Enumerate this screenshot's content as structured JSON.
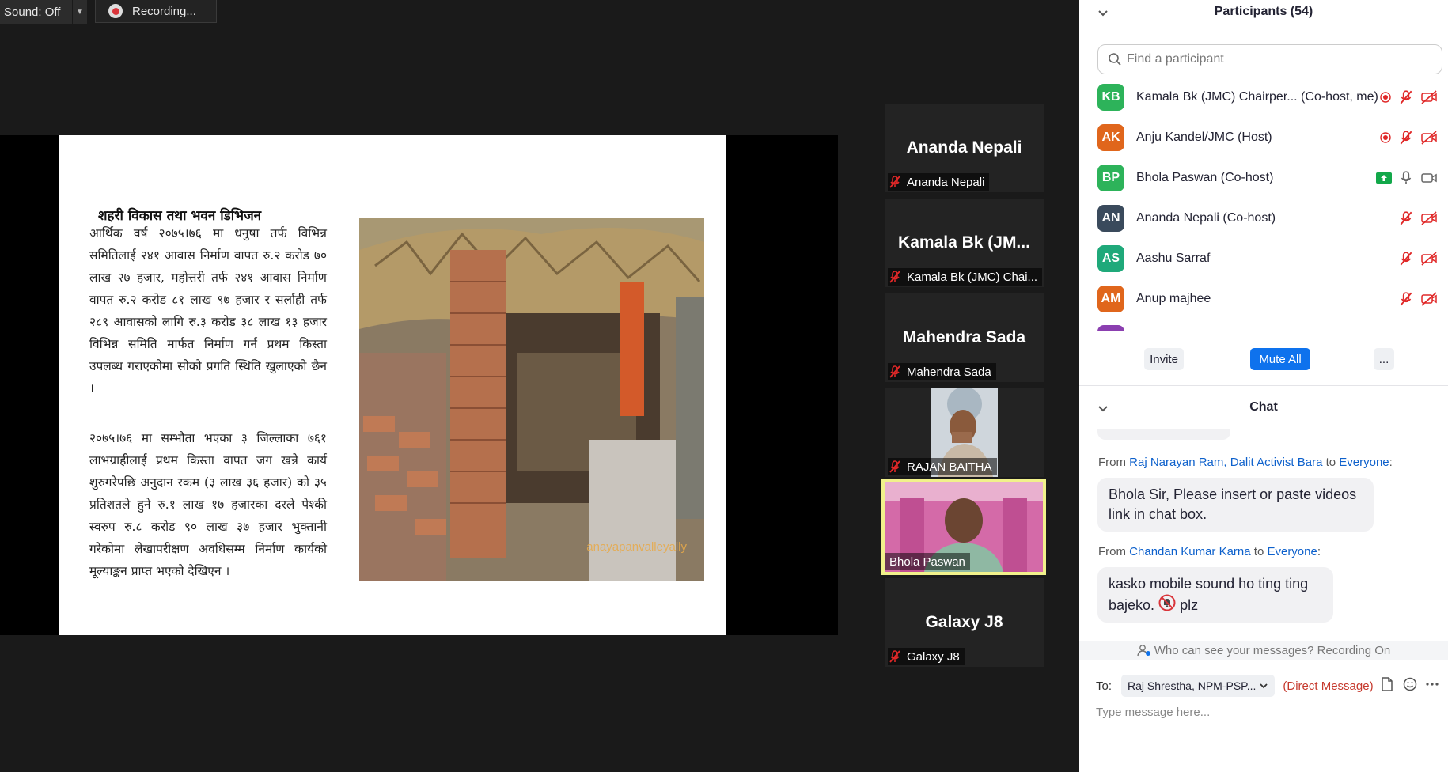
{
  "topbar": {
    "sound_label": "Sound: Off",
    "recording_label": "Recording..."
  },
  "slide": {
    "title": "शहरी विकास तथा भवन डिभिजन",
    "paragraph1": "आर्थिक वर्ष २०७५।७६ मा धनुषा तर्फ विभिन्न समितिलाई २४१ आवास निर्माण वापत रु.२ करोड ७० लाख २७ हजार, महोत्तरी तर्फ २४१ आवास निर्माण वापत रु.२ करोड ८१ लाख ९७ हजार र सर्लाही तर्फ २८९ आवासको लागि रु.३ करोड ३८ लाख १३ हजार विभिन्न समिति मार्फत निर्माण गर्न प्रथम किस्ता उपलब्ध गराएकोमा सोको प्रगति स्थिति खुलाएको छैन ।",
    "paragraph2": "२०७५।७६ मा सम्भौता भएका ३ जिल्लाका ७६१ लाभग्राहीलाई प्रथम किस्ता वापत जग खन्ने कार्य शुरुगरेपछि अनुदान रकम (३ लाख ३६ हजार) को ३५ प्रतिशतले हुने रु.१ लाख १७ हजारका दरले पेश्की स्वरुप रु.८ करोड ९० लाख ३७ हजार भुक्तानी गरेकोमा लेखापरीक्षण अवधिसम्म निर्माण कार्यको मूल्याङ्कन प्राप्त भएको देखिएन ।",
    "photo_watermark": "anayapanvalleyally"
  },
  "tiles": [
    {
      "display": "Ananda Nepali",
      "label": "Ananda Nepali",
      "video": false
    },
    {
      "display": "Kamala Bk  (JM...",
      "label": "Kamala Bk  (JMC) Chai...",
      "video": false
    },
    {
      "display": "Mahendra Sada",
      "label": "Mahendra Sada",
      "video": false
    },
    {
      "display": "",
      "label": "RAJAN BAITHA",
      "video": true
    },
    {
      "display": "",
      "label": "Bhola Paswan",
      "video": true
    },
    {
      "display": "Galaxy J8",
      "label": "Galaxy J8",
      "video": false
    }
  ],
  "participants_panel": {
    "title": "Participants (54)",
    "search_placeholder": "Find a participant",
    "participants": [
      {
        "initials": "KB",
        "color": "#2db35a",
        "name": "Kamala Bk  (JMC) Chairper...  (Co-host, me)"
      },
      {
        "initials": "AK",
        "color": "#e0661c",
        "name": "Anju Kandel/JMC (Host)"
      },
      {
        "initials": "BP",
        "color": "#2db35a",
        "name": "Bhola Paswan (Co-host)"
      },
      {
        "initials": "AN",
        "color": "#3a4a5c",
        "name": "Ananda Nepali (Co-host)"
      },
      {
        "initials": "AS",
        "color": "#1fa97a",
        "name": "Aashu Sarraf"
      },
      {
        "initials": "AM",
        "color": "#e0661c",
        "name": "Anup majhee"
      }
    ],
    "invite_label": "Invite",
    "mute_all_label": "Mute All",
    "more_label": "..."
  },
  "chat": {
    "title": "Chat",
    "messages": [
      {
        "from_word": "From",
        "sender": "Raj Narayan Ram, Dalit Activist Bara",
        "to_word": "to",
        "recipient": "Everyone",
        "colon": ":",
        "text": "Bhola Sir, Please insert or paste videos link in chat box."
      },
      {
        "from_word": "From",
        "sender": "Chandan Kumar Karna",
        "to_word": "to",
        "recipient": "Everyone",
        "colon": ":",
        "text_before": "kasko mobile sound ho ting ting bajeko.",
        "text_after": "plz"
      }
    ],
    "visibility_note": "Who can see your messages? Recording On",
    "to_label": "To:",
    "to_value": "Raj Shrestha, NPM-PSP...",
    "direct_message": "(Direct Message)",
    "input_placeholder": "Type message here..."
  },
  "colors": {
    "accent_blue": "#0e72ed",
    "link_blue": "#0e61cc",
    "mic_off_red": "#e02828",
    "active_speaker": "#f1f18b"
  }
}
